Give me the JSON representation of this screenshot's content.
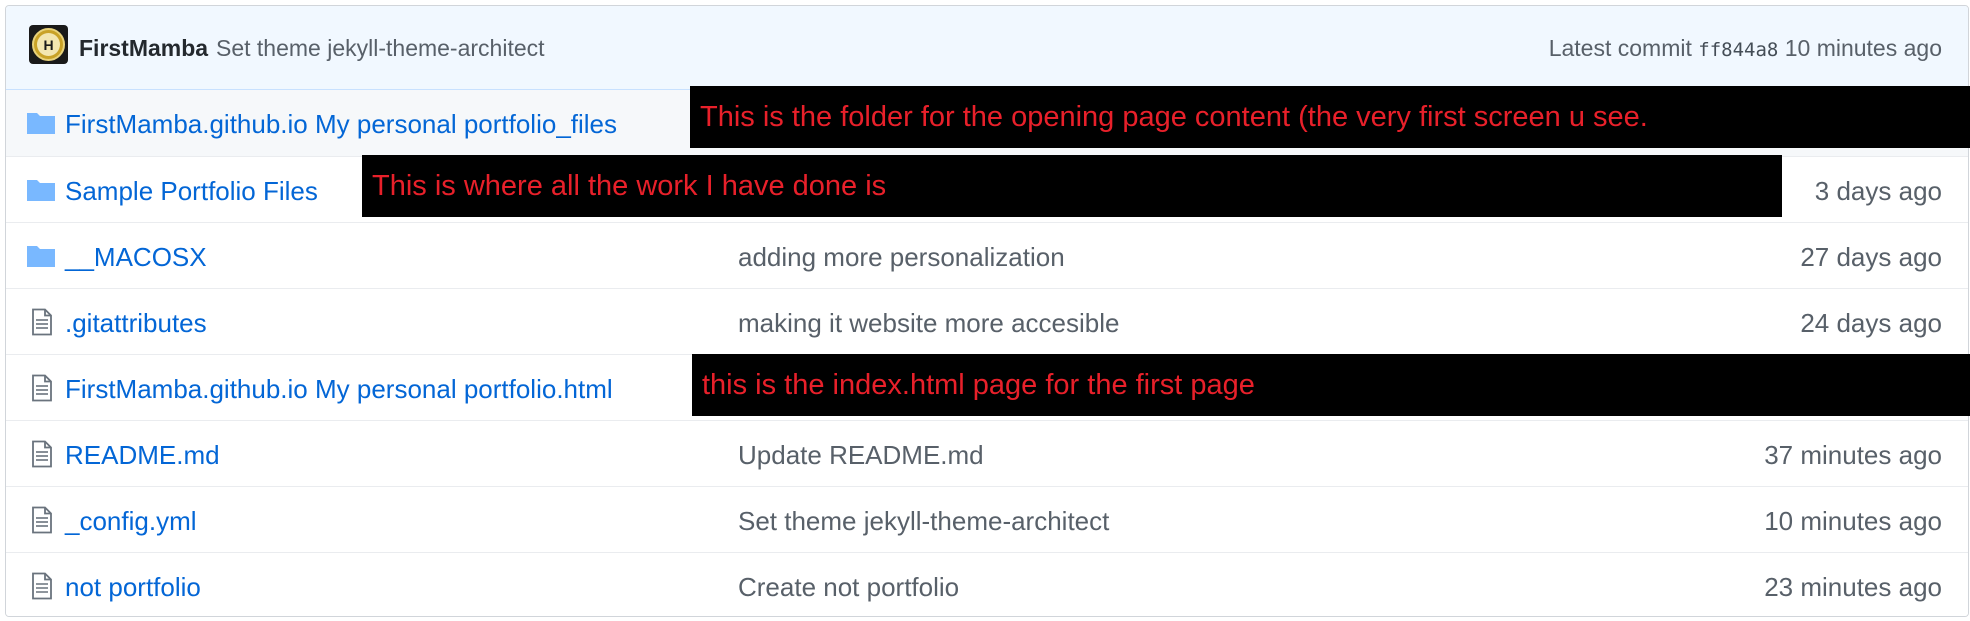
{
  "commit": {
    "author": "FirstMamba",
    "message": "Set theme jekyll-theme-architect",
    "latest_label": "Latest commit",
    "sha": "ff844a8",
    "age": "10 minutes ago"
  },
  "files": [
    {
      "type": "folder",
      "name": "FirstMamba.github.io My personal portfolio_files",
      "message": "",
      "age": ""
    },
    {
      "type": "folder",
      "name": "Sample Portfolio Files",
      "message": "",
      "age": "3 days ago"
    },
    {
      "type": "folder",
      "name": "__MACOSX",
      "message": "adding more personalization",
      "age": "27 days ago"
    },
    {
      "type": "file",
      "name": ".gitattributes",
      "message": "making it website more accesible",
      "age": "24 days ago"
    },
    {
      "type": "file",
      "name": "FirstMamba.github.io My personal portfolio.html",
      "message": "",
      "age": ""
    },
    {
      "type": "file",
      "name": "README.md",
      "message": "Update README.md",
      "age": "37 minutes ago"
    },
    {
      "type": "file",
      "name": "_config.yml",
      "message": "Set theme jekyll-theme-architect",
      "age": "10 minutes ago"
    },
    {
      "type": "file",
      "name": "not portfolio",
      "message": "Create not portfolio",
      "age": "23 minutes ago"
    }
  ],
  "annotations": [
    "This is the folder for the opening page content (the very first screen u see.",
    "This is where all the work I have done is",
    "this is the index.html  page for the first page"
  ],
  "icons": {
    "folder": "folder-icon",
    "file": "file-icon",
    "avatar": "avatar-logo"
  },
  "colors": {
    "link": "#0366d6",
    "muted": "#586069",
    "header_bg": "#f1f8ff",
    "folder_icon": "#79b8ff",
    "file_icon": "#6a737d",
    "annotation_bg": "#000000",
    "annotation_text": "#e8202a"
  }
}
